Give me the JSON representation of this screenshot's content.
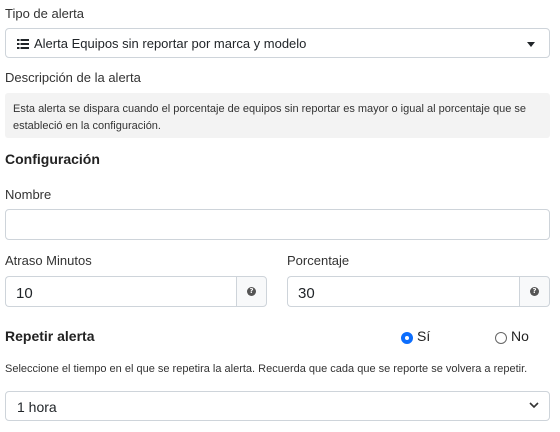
{
  "alert_type": {
    "label": "Tipo de alerta",
    "selected": "Alerta Equipos sin reportar por marca y modelo",
    "icon": "list-icon"
  },
  "description": {
    "label": "Descripción de la alerta",
    "text": "Esta alerta se dispara cuando el porcentaje de equipos sin reportar es mayor o igual al porcentaje que se estableció en la configuración."
  },
  "config": {
    "heading": "Configuración",
    "name_label": "Nombre",
    "name_value": "",
    "delay_label": "Atraso Minutos",
    "delay_value": "10",
    "percent_label": "Porcentaje",
    "percent_value": "30",
    "help_icon": "question-circle-icon"
  },
  "repeat": {
    "heading": "Repetir alerta",
    "yes_label": "Sí",
    "no_label": "No",
    "selected": "yes",
    "help_text": "Seleccione el tiempo en el que se repetira la alerta. Recuerda que cada que se reporte se volvera a repetir.",
    "interval_selected": "1 hora"
  },
  "colors": {
    "accent": "#0d6efd",
    "description_bg": "#f3f3f3",
    "border": "#ced4da"
  }
}
